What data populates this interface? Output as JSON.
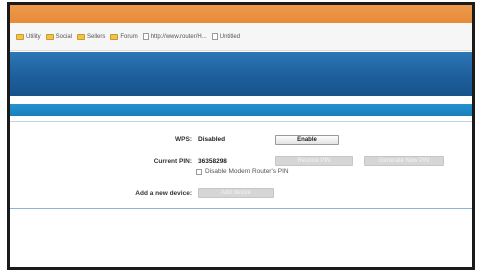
{
  "colors": {
    "titlebar": "#e98f40",
    "banner": "#1d5f9c",
    "stripe": "#2493cf"
  },
  "bookmarks": [
    {
      "icon": "folder-icon",
      "label": "Utility"
    },
    {
      "icon": "folder-icon",
      "label": "Social"
    },
    {
      "icon": "folder-icon",
      "label": "Sellers"
    },
    {
      "icon": "folder-icon",
      "label": "Forum"
    },
    {
      "icon": "page-icon",
      "label": "http://www.router/H..."
    },
    {
      "icon": "page-icon",
      "label": "Untitled"
    }
  ],
  "wps": {
    "label": "WPS:",
    "status": "Disabled",
    "enable_button": "Enable"
  },
  "pin": {
    "label": "Current PIN:",
    "value": "36358298",
    "restore_button": "Restore PIN",
    "generate_button": "Generate New PIN",
    "disable_checkbox_label": "Disable Modem Router's PIN",
    "disable_checked": false
  },
  "device": {
    "label": "Add a new device:",
    "add_button": "Add device"
  }
}
